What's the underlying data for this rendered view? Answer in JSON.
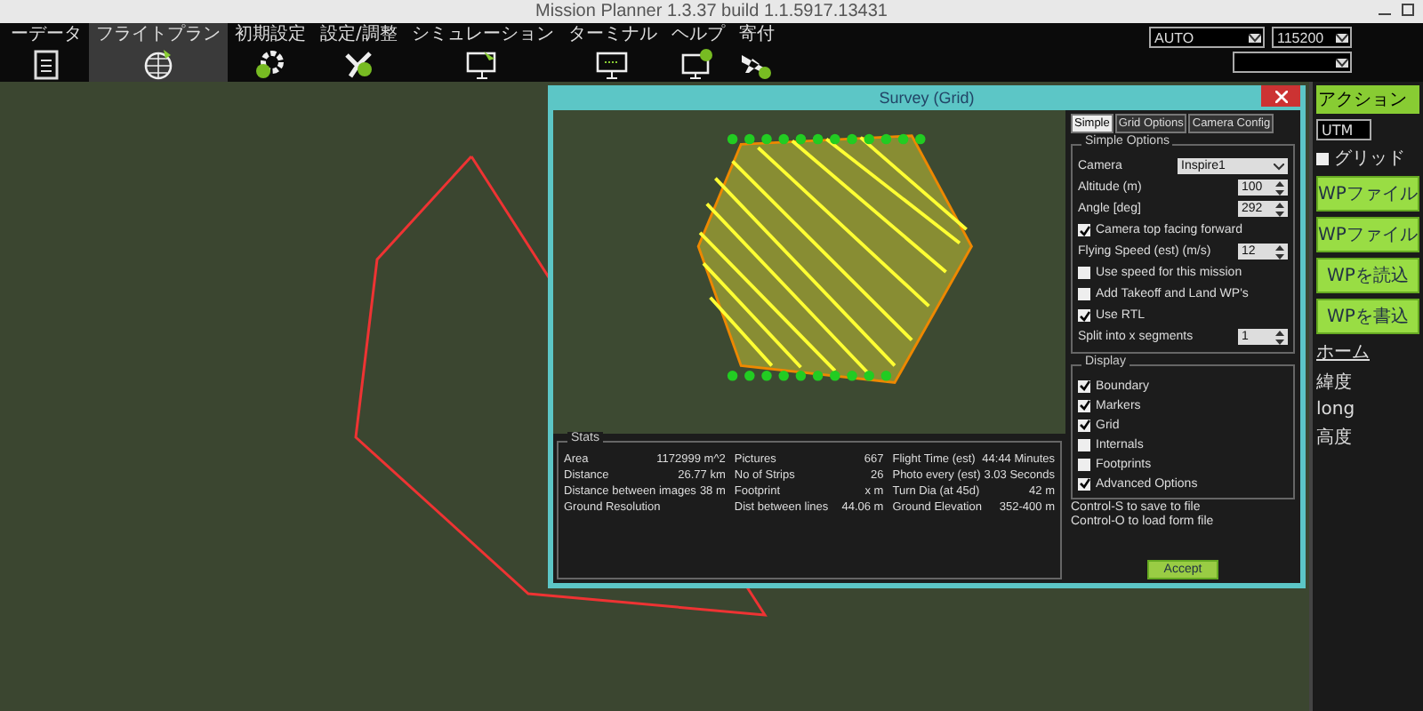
{
  "window": {
    "title": "Mission Planner 1.3.37 build 1.1.5917.13431"
  },
  "toolbar": [
    {
      "label": "ーデータ",
      "selected": false
    },
    {
      "label": "フライトプラン",
      "selected": true
    },
    {
      "label": "初期設定",
      "selected": false
    },
    {
      "label": "設定/調整",
      "selected": false
    },
    {
      "label": "シミュレーション",
      "selected": false
    },
    {
      "label": "ターミナル",
      "selected": false
    },
    {
      "label": "ヘルプ",
      "selected": false
    },
    {
      "label": "寄付",
      "selected": false
    }
  ],
  "connection": {
    "mode": "AUTO",
    "baud": "115200"
  },
  "survey": {
    "title": "Survey (Grid)",
    "tabs": [
      {
        "label": "Simple",
        "selected": true
      },
      {
        "label": "Grid Options",
        "selected": false
      },
      {
        "label": "Camera Config",
        "selected": false
      }
    ],
    "simple_options": {
      "heading": "Simple Options",
      "rows": [
        {
          "kind": "select",
          "label": "Camera",
          "value": "Inspire1"
        },
        {
          "kind": "spin",
          "label": "Altitude (m)",
          "value": "100"
        },
        {
          "kind": "spin",
          "label": "Angle [deg]",
          "value": "292"
        },
        {
          "kind": "check",
          "label": "Camera top facing forward",
          "checked": true
        },
        {
          "kind": "spin",
          "label": "Flying Speed (est) (m/s)",
          "value": "12"
        },
        {
          "kind": "check",
          "label": "Use speed for this mission",
          "checked": false
        },
        {
          "kind": "check",
          "label": "Add Takeoff and Land WP's",
          "checked": false
        },
        {
          "kind": "check",
          "label": "Use RTL",
          "checked": true
        },
        {
          "kind": "spin",
          "label": "Split into x segments",
          "value": "1"
        }
      ]
    },
    "display": {
      "heading": "Display",
      "items": [
        {
          "label": "Boundary",
          "checked": true
        },
        {
          "label": "Markers",
          "checked": true
        },
        {
          "label": "Grid",
          "checked": true
        },
        {
          "label": "Internals",
          "checked": false
        },
        {
          "label": "Footprints",
          "checked": false
        },
        {
          "label": "Advanced Options",
          "checked": true
        }
      ]
    },
    "hints": [
      "Control-S to save to file",
      "Control-O to load form file"
    ],
    "accept": "Accept",
    "stats": {
      "heading": "Stats",
      "columns": [
        [
          {
            "label": "Area",
            "value": "1172999 m^2"
          },
          {
            "label": "Distance",
            "value": "26.77 km"
          },
          {
            "label": "Distance between images",
            "value": "38 m"
          },
          {
            "label": "Ground Resolution"
          }
        ],
        [
          {
            "label": "Pictures",
            "value": "667"
          },
          {
            "label": "No of Strips",
            "value": "26"
          },
          {
            "label": "Footprint",
            "value": "x m"
          },
          {
            "label": "Dist between lines",
            "value": "44.06 m"
          }
        ],
        [
          {
            "label": "Flight Time (est)",
            "value": "44:44 Minutes"
          },
          {
            "label": "Photo every (est)",
            "value": "3.03 Seconds"
          },
          {
            "label": "Turn Dia (at 45d)",
            "value": "42 m"
          },
          {
            "label": "Ground Elevation",
            "value": "352-400 m"
          }
        ]
      ]
    }
  },
  "side_panel": {
    "title": "アクション",
    "coords": "UTM",
    "grid": {
      "label": "グリッド",
      "checked": false
    },
    "buttons": [
      "WPファイル",
      "WPファイル",
      "WPを読込",
      "WPを書込"
    ],
    "home": "ホーム",
    "fields": [
      "緯度",
      "long",
      "高度"
    ]
  }
}
